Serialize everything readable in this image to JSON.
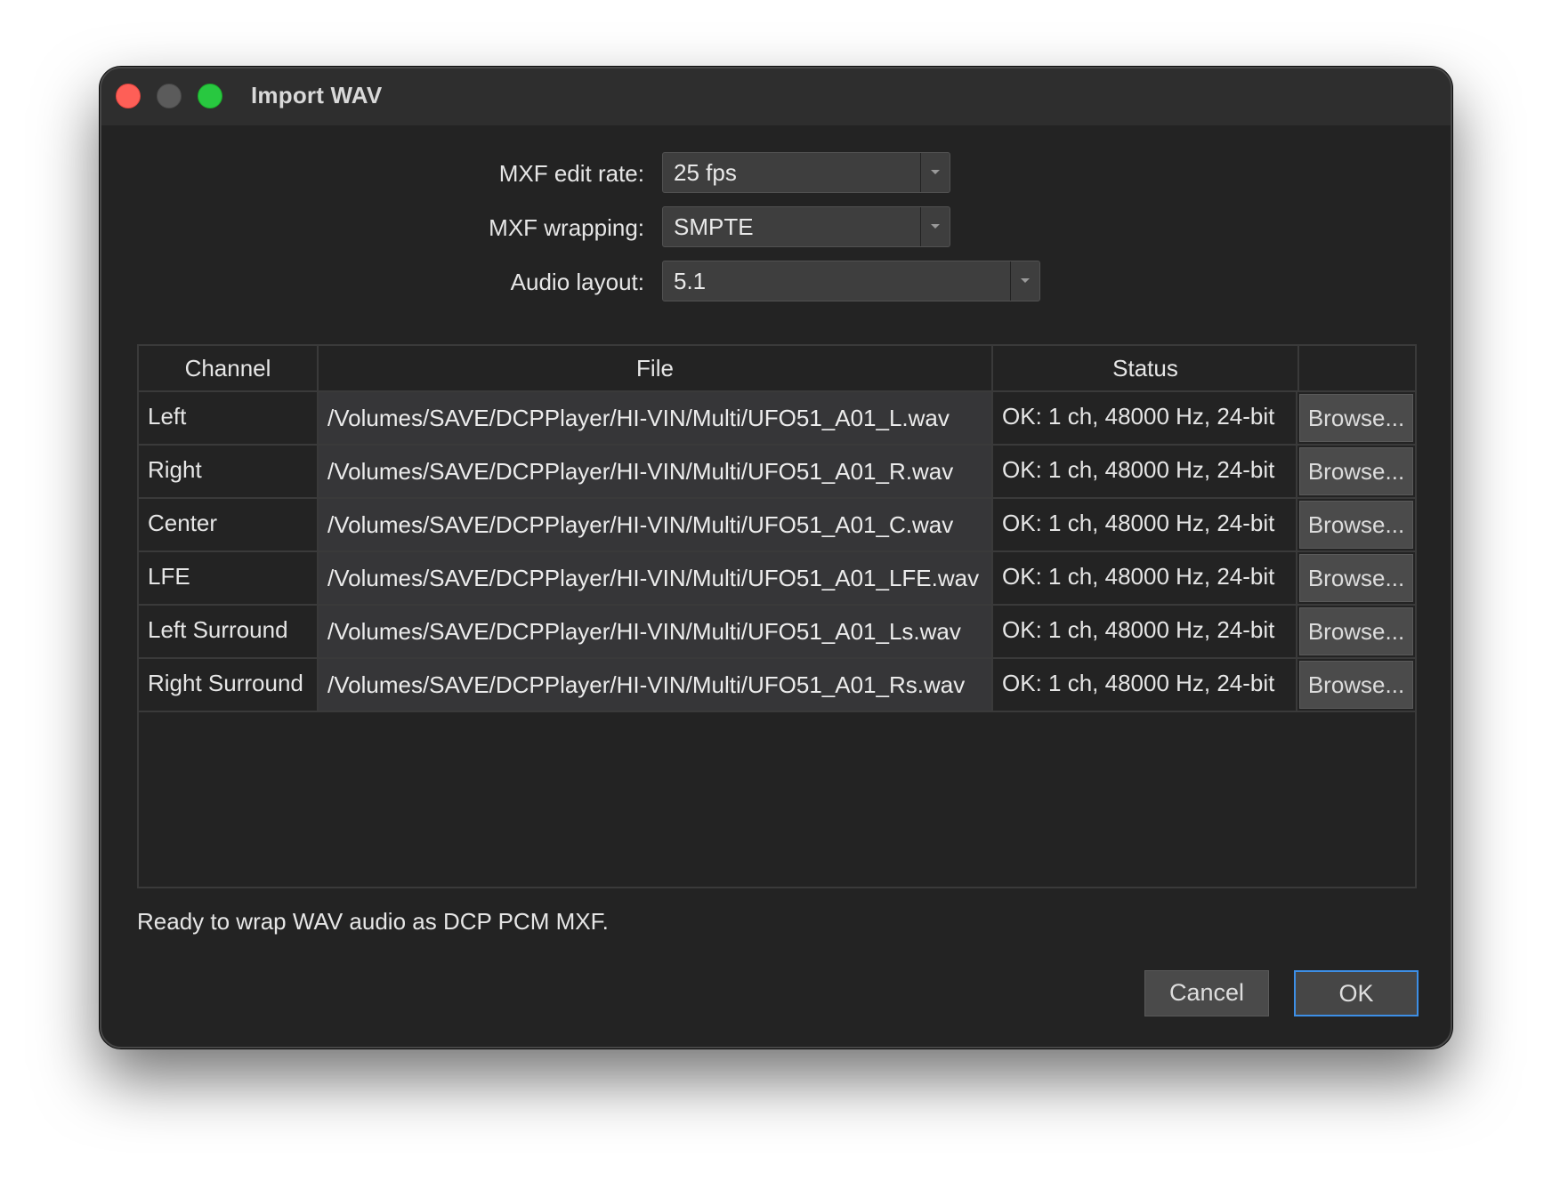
{
  "window": {
    "title": "Import WAV"
  },
  "form": {
    "edit_rate_label": "MXF edit rate:",
    "edit_rate_value": "25 fps",
    "wrapping_label": "MXF wrapping:",
    "wrapping_value": "SMPTE",
    "layout_label": "Audio layout:",
    "layout_value": "5.1"
  },
  "table": {
    "headers": [
      "Channel",
      "File",
      "Status",
      ""
    ],
    "rows": [
      {
        "channel": "Left",
        "file": "/Volumes/SAVE/DCPPlayer/HI-VIN/Multi/UFO51_A01_L.wav",
        "status": "OK: 1 ch, 48000 Hz, 24-bit",
        "browse": "Browse..."
      },
      {
        "channel": "Right",
        "file": "/Volumes/SAVE/DCPPlayer/HI-VIN/Multi/UFO51_A01_R.wav",
        "status": "OK: 1 ch, 48000 Hz, 24-bit",
        "browse": "Browse..."
      },
      {
        "channel": "Center",
        "file": "/Volumes/SAVE/DCPPlayer/HI-VIN/Multi/UFO51_A01_C.wav",
        "status": "OK: 1 ch, 48000 Hz, 24-bit",
        "browse": "Browse..."
      },
      {
        "channel": "LFE",
        "file": "/Volumes/SAVE/DCPPlayer/HI-VIN/Multi/UFO51_A01_LFE.wav",
        "status": "OK: 1 ch, 48000 Hz, 24-bit",
        "browse": "Browse..."
      },
      {
        "channel": "Left Surround",
        "file": "/Volumes/SAVE/DCPPlayer/HI-VIN/Multi/UFO51_A01_Ls.wav",
        "status": "OK: 1 ch, 48000 Hz, 24-bit",
        "browse": "Browse..."
      },
      {
        "channel": "Right Surround",
        "file": "/Volumes/SAVE/DCPPlayer/HI-VIN/Multi/UFO51_A01_Rs.wav",
        "status": "OK: 1 ch, 48000 Hz, 24-bit",
        "browse": "Browse..."
      }
    ]
  },
  "status_message": "Ready to wrap WAV audio as DCP PCM MXF.",
  "buttons": {
    "cancel": "Cancel",
    "ok": "OK"
  },
  "colors": {
    "close": "#fe5f57",
    "minimize": "#5b5b5b",
    "zoom": "#28c840",
    "accent": "#3d8fe6"
  },
  "icons": {
    "combo_arrow": "chevron-down-icon"
  }
}
